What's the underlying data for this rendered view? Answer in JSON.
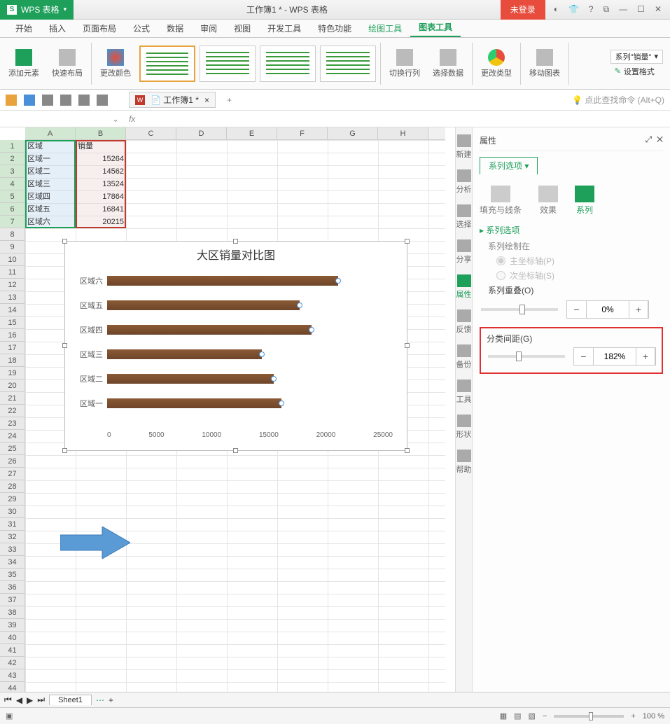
{
  "app": {
    "name": "WPS 表格",
    "doc_title": "工作簿1 * - WPS 表格",
    "login": "未登录"
  },
  "menu": {
    "tabs": [
      "开始",
      "插入",
      "页面布局",
      "公式",
      "数据",
      "审阅",
      "视图",
      "开发工具",
      "特色功能",
      "绘图工具",
      "图表工具"
    ],
    "active": 10
  },
  "ribbon": {
    "add_element": "添加元素",
    "quick_layout": "快速布局",
    "change_color": "更改颜色",
    "switch_rowcol": "切换行列",
    "select_data": "选择数据",
    "change_type": "更改类型",
    "move_chart": "移动图表",
    "series_label": "系列\"销量\"",
    "set_format": "设置格式"
  },
  "qat": {
    "doc_tab": "工作簿1 *",
    "search_hint": "点此查找命令  (Alt+Q)"
  },
  "fx": {
    "namebox": ""
  },
  "sheet": {
    "cols": [
      "A",
      "B",
      "C",
      "D",
      "E",
      "F",
      "G",
      "H"
    ],
    "rows_visible": 44,
    "data": [
      [
        "区域",
        "销量"
      ],
      [
        "区域一",
        "15264"
      ],
      [
        "区域二",
        "14562"
      ],
      [
        "区域三",
        "13524"
      ],
      [
        "区域四",
        "17864"
      ],
      [
        "区域五",
        "16841"
      ],
      [
        "区域六",
        "20215"
      ]
    ],
    "tab": "Sheet1"
  },
  "chart_data": {
    "type": "bar",
    "title": "大区销量对比图",
    "categories": [
      "区域一",
      "区域二",
      "区域三",
      "区域四",
      "区域五",
      "区域六"
    ],
    "values": [
      15264,
      14562,
      13524,
      17864,
      16841,
      20215
    ],
    "xlim": [
      0,
      25000
    ],
    "xticks": [
      0,
      5000,
      10000,
      15000,
      20000,
      25000
    ],
    "orientation": "horizontal"
  },
  "side": {
    "items": [
      "新建",
      "分析",
      "选择",
      "分享",
      "属性",
      "反馈",
      "备份",
      "工具",
      "形状",
      "帮助"
    ],
    "active": 4
  },
  "panel": {
    "title": "属性",
    "series_tab": "系列选项",
    "opts": {
      "fill": "填充与线条",
      "effect": "效果",
      "series": "系列"
    },
    "section": "系列选项",
    "draw_on": "系列绘制在",
    "axis_primary": "主坐标轴(P)",
    "axis_secondary": "次坐标轴(S)",
    "overlap_label": "系列重叠(O)",
    "overlap_value": "0%",
    "gap_label": "分类间距(G)",
    "gap_value": "182%"
  },
  "status": {
    "zoom": "100 %"
  }
}
